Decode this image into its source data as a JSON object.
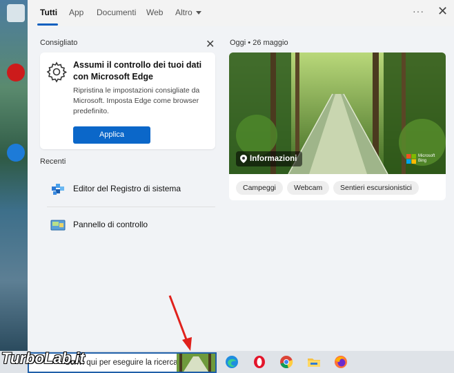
{
  "tabs": {
    "all": "Tutti",
    "apps": "App",
    "documents": "Documenti",
    "web": "Web",
    "more": "Altro"
  },
  "header": {
    "more_options": "···",
    "close": "✕"
  },
  "recommended": {
    "title": "Consigliato",
    "close": "✕",
    "card": {
      "icon": "gear-icon",
      "title": "Assumi il controllo dei tuoi dati con Microsoft Edge",
      "description": "Ripristina le impostazioni consigliate da Microsoft. Imposta Edge come browser predefinito.",
      "button": "Applica"
    }
  },
  "recent": {
    "title": "Recenti",
    "items": [
      {
        "label": "Editor del Registro di sistema",
        "icon": "registry-editor-icon"
      },
      {
        "label": "Pannello di controllo",
        "icon": "control-panel-icon"
      }
    ]
  },
  "today": {
    "date_label": "Oggi  •  26 maggio",
    "info_label": "Informazioni",
    "brand_line1": "Microsoft",
    "brand_line2": "Bing",
    "chips": [
      "Campeggi",
      "Webcam",
      "Sentieri escursionistici"
    ]
  },
  "taskbar": {
    "search_text": "Scrivi qui per eseguire la ricerca",
    "apps": [
      "edge-icon",
      "opera-icon",
      "chrome-icon",
      "file-explorer-icon",
      "firefox-icon"
    ]
  },
  "watermark": "TurboLab.it",
  "colors": {
    "accent": "#0b67c9",
    "panel": "#f1f3f6",
    "arrow": "#e0211c"
  }
}
